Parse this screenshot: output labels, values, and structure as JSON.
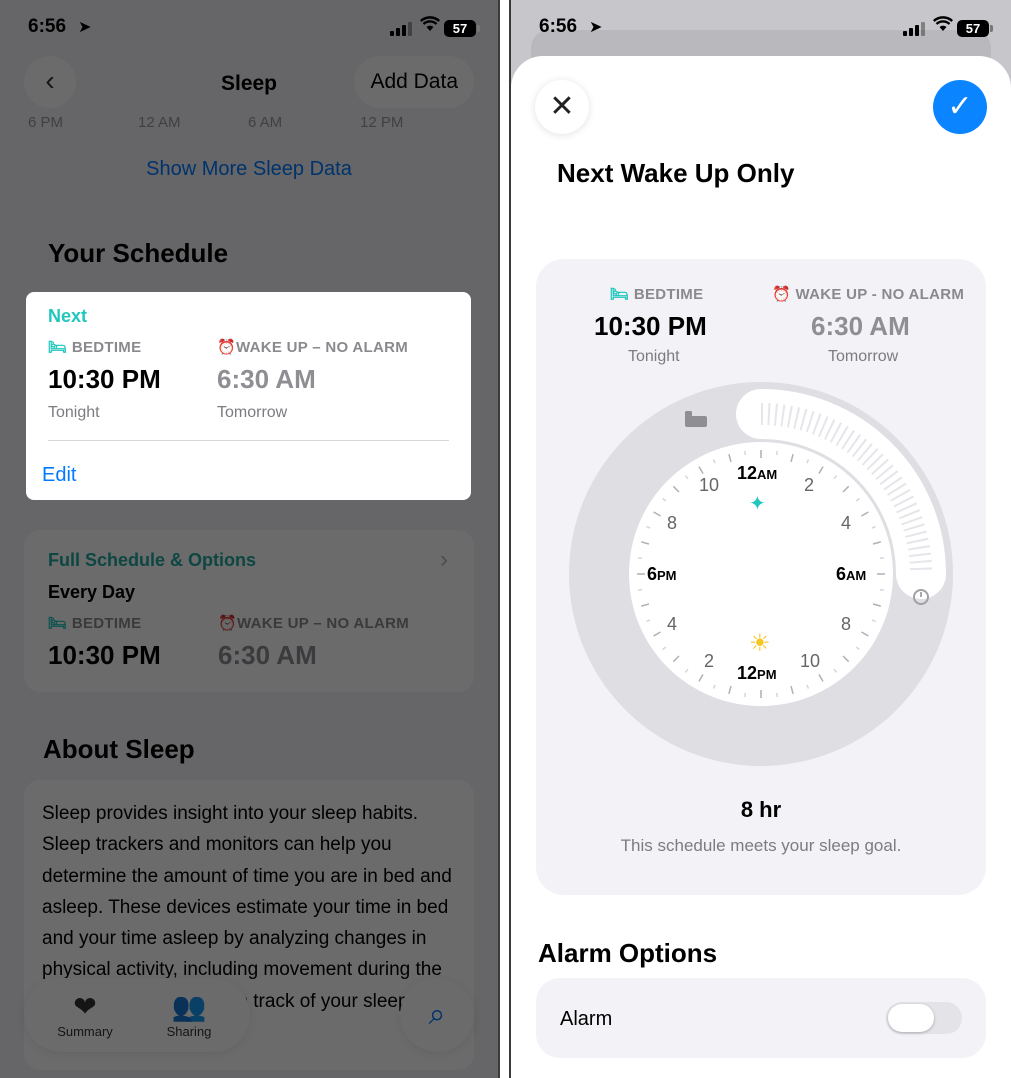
{
  "status_left": {
    "time": "6:56",
    "battery": "57"
  },
  "status_right": {
    "time": "6:56",
    "battery": "57"
  },
  "left": {
    "nav": {
      "title": "Sleep",
      "add_label": "Add Data"
    },
    "axis_ticks": [
      "6 PM",
      "12 AM",
      "6 AM",
      "12 PM"
    ],
    "show_more": "Show More Sleep Data",
    "schedule_heading": "Your Schedule",
    "next_card": {
      "label": "Next",
      "bedtime_label": "BEDTIME",
      "bedtime": "10:30 PM",
      "bedtime_day": "Tonight",
      "wake_label": "WAKE UP – NO ALARM",
      "wake": "6:30 AM",
      "wake_day": "Tomorrow",
      "edit": "Edit"
    },
    "full_card": {
      "title": "Full Schedule & Options",
      "days": "Every Day",
      "bedtime_label": "BEDTIME",
      "bedtime": "10:30 PM",
      "wake_label": "WAKE UP – NO ALARM",
      "wake": "6:30 AM"
    },
    "about_heading": "About Sleep",
    "about_text": "Sleep provides insight into your sleep habits. Sleep trackers and monitors can help you determine the amount of time you are in bed and asleep. These devices estimate your time in bed and your time asleep by analyzing changes in physical activity, including movement during the night. You can also keep track of your sleep by entering your",
    "tabs": [
      {
        "label": "Summary"
      },
      {
        "label": "Sharing"
      }
    ]
  },
  "right": {
    "title": "Next Wake Up Only",
    "bedtime_label": "BEDTIME",
    "bedtime": "10:30 PM",
    "bedtime_day": "Tonight",
    "wake_label": "WAKE UP - NO ALARM",
    "wake": "6:30 AM",
    "wake_day": "Tomorrow",
    "clock": {
      "top_num": "12",
      "top_suffix": "AM",
      "bottom_num": "12",
      "bottom_suffix": "PM",
      "left_num": "6",
      "left_suffix": "PM",
      "right_num": "6",
      "right_suffix": "AM",
      "hour_labels": [
        "2",
        "4",
        "8",
        "10",
        "2",
        "4",
        "8",
        "10"
      ]
    },
    "duration": "8 hr",
    "goal_text": "This schedule meets your sleep goal.",
    "alarm_heading": "Alarm Options",
    "alarm_label": "Alarm"
  },
  "colors": {
    "accent_blue": "#007aff",
    "teal": "#1fc7bd",
    "sun": "#f7c51e",
    "confirm_blue": "#0a84ff"
  }
}
